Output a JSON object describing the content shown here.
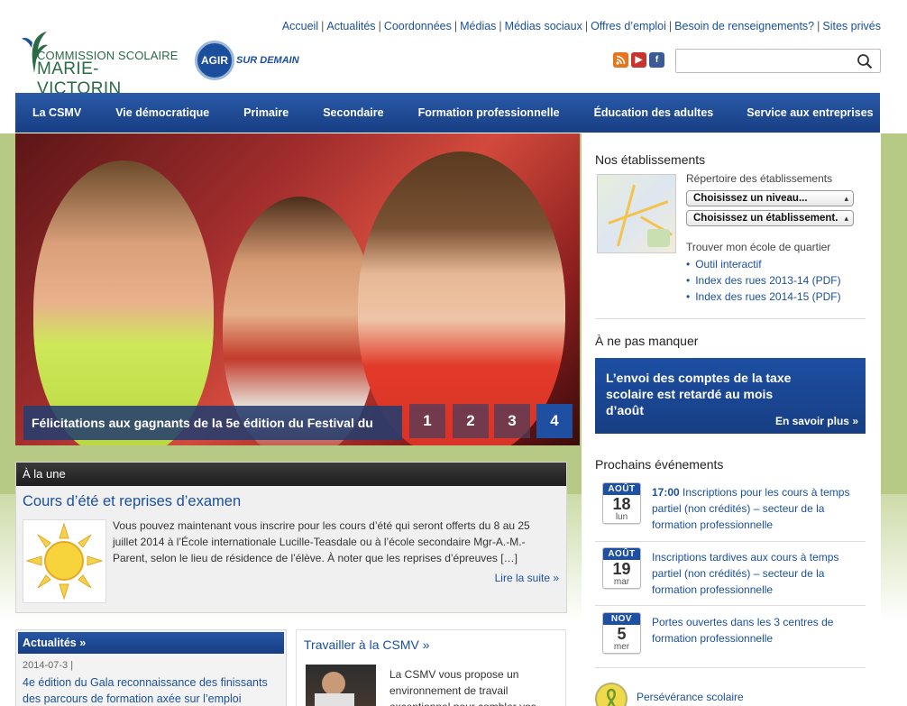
{
  "header": {
    "top_links": [
      "Accueil",
      "Actualités",
      "Coordonnées",
      "Médias",
      "Médias sociaux",
      "Offres d’emploi",
      "Besoin de renseignements?",
      "Sites privés"
    ],
    "logo_line1": "COMMISSION SCOLAIRE",
    "logo_line2": "MARIE-VICTORIN",
    "agir_label": "AGIR",
    "agir_sub": "SUR DEMAIN",
    "search_placeholder": "",
    "social_icons": [
      "rss-icon",
      "youtube-icon",
      "facebook-icon"
    ]
  },
  "nav": {
    "items": [
      "La CSMV",
      "Vie démocratique",
      "Primaire",
      "Secondaire",
      "Formation professionnelle",
      "Éducation des adultes",
      "Service aux entreprises"
    ]
  },
  "hero": {
    "caption": "Félicitations aux gagnants de la 5e édition du Festival du",
    "slides": [
      "1",
      "2",
      "3",
      "4"
    ],
    "active_slide": 4
  },
  "une": {
    "heading": "À la une",
    "title": "Cours d’été et reprises d’examen",
    "text": "Vous pouvez maintenant vous inscrire pour les cours d’été qui seront offerts du 8 au 25 juillet 2014 à l’École internationale Lucille-Teasdale ou à l’école secondaire Mgr-A.-M.-Parent, selon le lieu de résidence de l’élève. À noter que les reprises d’épreuves […]",
    "more": "Lire la suite »"
  },
  "actualites": {
    "heading": "Actualités »",
    "date": "2014-07-3 |",
    "link": "4e édition du Gala reconnaissance des finissants des parcours de formation axée sur l’emploi"
  },
  "travailler": {
    "title": "Travailler à la CSMV »",
    "text": "La CSMV vous propose un environnement de travail exceptionnel pour combler vos"
  },
  "etablissements": {
    "title": "Nos établissements",
    "repertoire": "Répertoire des établissements",
    "select_level": "Choisissez un niveau...",
    "select_school": "Choisissez un établissement.",
    "trouver": "Trouver mon école de quartier",
    "links": [
      "Outil interactif",
      "Index des rues 2013-14 (PDF)",
      "Index des rues 2014-15 (PDF)"
    ]
  },
  "ne_pas_manquer": {
    "title": "À ne pas manquer",
    "promo_text": "L’envoi des comptes de la taxe scolaire est retardé au mois d’août",
    "promo_more": "En savoir plus »"
  },
  "evenements": {
    "title": "Prochains événements",
    "items": [
      {
        "month": "AOÛT",
        "day": "18",
        "weekday": "lun",
        "time": "17:00",
        "text": " Inscriptions pour les cours à temps partiel (non crédités) – secteur de la formation professionnelle"
      },
      {
        "month": "AOÛT",
        "day": "19",
        "weekday": "mar",
        "time": "",
        "text": "Inscriptions tardives aux cours à temps partiel (non crédités) – secteur de la formation professionnelle"
      },
      {
        "month": "NOV",
        "day": "5",
        "weekday": "mer",
        "time": "",
        "text": "Portes ouvertes dans les 3 centres de formation professionnelle"
      }
    ]
  },
  "perseverance": {
    "label": "Persévérance scolaire"
  },
  "colors": {
    "primary_blue": "#1d4fa2",
    "green_band": "#b6c985",
    "link_blue": "#1a4f9c"
  }
}
